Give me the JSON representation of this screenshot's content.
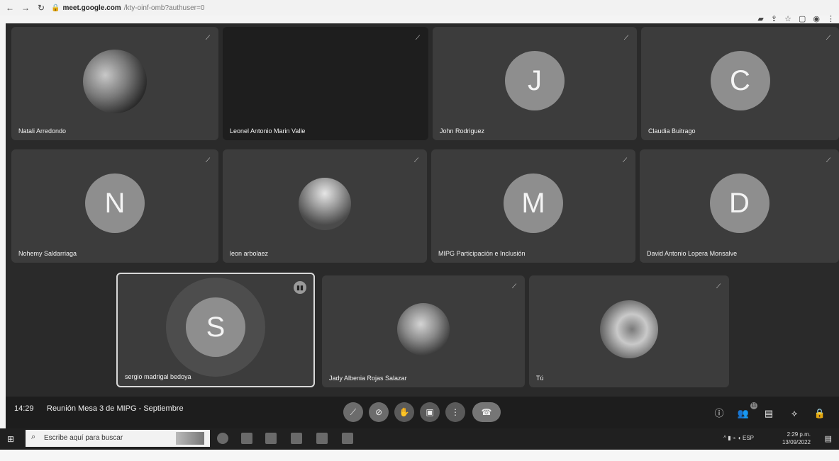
{
  "browser": {
    "url_host": "meet.google.com",
    "url_path": "/kty-oinf-omb?authuser=0",
    "icons": [
      "back-icon",
      "forward-icon",
      "reload-icon",
      "lock-icon",
      "cast-icon",
      "share-icon",
      "star-icon",
      "tab-icon",
      "profile-icon",
      "menu-icon"
    ]
  },
  "participants": [
    {
      "name": "Natali Arredondo",
      "type": "photo"
    },
    {
      "name": "Leonel Antonio Marin Valle",
      "type": "dark"
    },
    {
      "name": "John Rodriguez",
      "initial": "J"
    },
    {
      "name": "Claudia Buitrago",
      "initial": "C"
    },
    {
      "name": "Nohemy Saldarriaga",
      "initial": "N"
    },
    {
      "name": "leon arbolaez",
      "type": "photo"
    },
    {
      "name": "MIPG Participación e Inclusión",
      "initial": "M"
    },
    {
      "name": "David Antonio Lopera Monsalve",
      "initial": "D"
    },
    {
      "name": "sergio madrigal bedoya",
      "initial": "S",
      "speaking": true
    },
    {
      "name": "Jady Albenia Rojas Salazar",
      "type": "photo"
    },
    {
      "name": "Tú",
      "type": "photo"
    }
  ],
  "meeting": {
    "time": "14:29",
    "title": "Reunión Mesa 3 de MIPG - Septiembre",
    "people_count": "11"
  },
  "taskbar": {
    "search_placeholder": "Escribe aquí para buscar",
    "time": "2:29 p.m.",
    "date": "13/09/2022"
  },
  "colors": {
    "stage_bg": "#2a2a2a",
    "tile_bg": "#3c3c3c",
    "avatar_bg": "#8e8e8e"
  }
}
